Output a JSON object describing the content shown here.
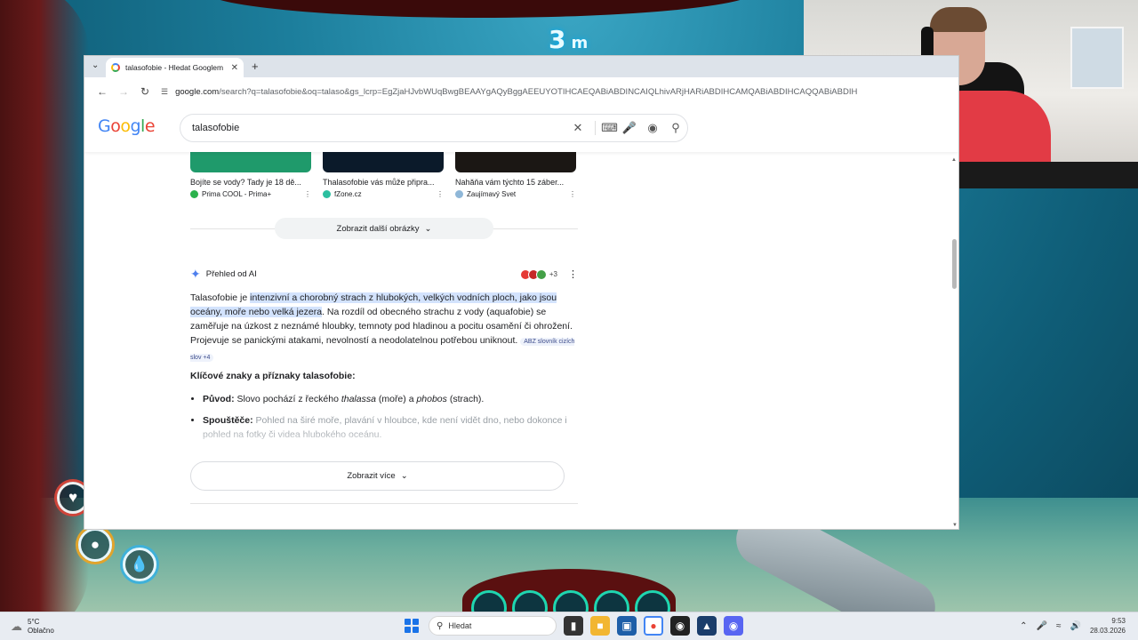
{
  "game": {
    "depth_value": "3",
    "depth_unit": "m"
  },
  "browser": {
    "tab": {
      "title": "talasofobie - Hledat Googlem"
    },
    "url_host": "google.com",
    "url_path": "/search?q=talasofobie&oq=talaso&gs_lcrp=EgZjaHJvbWUqBwgBEAAYgAQyBggAEEUYOTIHCAEQABiABDINCAIQLhivARjHARiABDIHCAMQABiABDIHCAQQABiABDIH"
  },
  "search": {
    "query": "talasofobie",
    "logo": [
      "G",
      "o",
      "o",
      "g",
      "l",
      "e"
    ]
  },
  "images": [
    {
      "caption": "Bojíte se vody? Tady je 18 dě...",
      "source": "Prima COOL - Prima+",
      "color": "#1f9a6b",
      "dot": "#2bb24c"
    },
    {
      "caption": "Thalasofobie vás může připra...",
      "source": "fZone.cz",
      "color": "#0b1a2a",
      "dot": "#2cbfa0"
    },
    {
      "caption": "Nahăňa vám týchto 15 záber...",
      "source": "Zaujímavý Svet",
      "color": "#1b1714",
      "dot": "#8fb7d8"
    }
  ],
  "more_images_label": "Zobrazit další obrázky",
  "ai_overview": {
    "title": "Přehled od AI",
    "avatar_more": "+3",
    "intro_before": "Talasofobie je ",
    "intro_highlight": "intenzivní a chorobný strach z hlubokých, velkých vodních ploch, jako jsou oceány, moře nebo velká jezera",
    "intro_after": ". Na rozdíl od obecného strachu z vody (aquafobie) se zaměřuje na úzkost z neznámé hloubky, temnoty pod hladinou a pocitu osamění či ohrožení. Projevuje se panickými atakami, nevolností a neodolatelnou potřebou uniknout.",
    "citation": "ABZ slovník cizích slov +4",
    "subheading": "Klíčové znaky a příznaky talasofobie:",
    "items": [
      {
        "label": "Původ:",
        "text_a": " Slovo pochází z řeckého ",
        "em1": "thalassa",
        "text_b": " (moře) a ",
        "em2": "phobos",
        "text_c": " (strach)."
      },
      {
        "label": "Spouštěče:",
        "text": " Pohled na širé moře, plavání v hloubce, kde není vidět dno, nebo dokonce i pohled na fotky či videa hlubokého oceánu."
      }
    ],
    "show_more_label": "Zobrazit více"
  },
  "taskbar": {
    "weather_temp": "5°C",
    "weather_desc": "Oblačno",
    "search_placeholder": "Hledat",
    "time": "9:53",
    "date": "28.03.2026"
  }
}
